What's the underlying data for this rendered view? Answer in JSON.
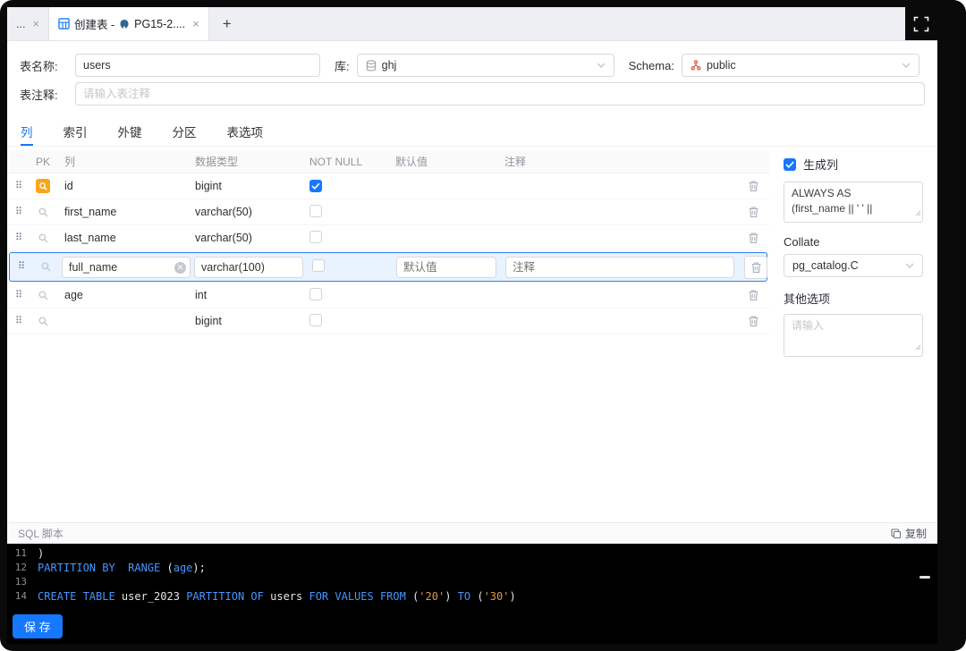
{
  "colors": {
    "accent": "#1677ff",
    "pk_badge": "#f6a71d",
    "sql_keyword": "#4596ff",
    "sql_string": "#de9a4a",
    "selected_row_bg": "#e9f2ff"
  },
  "window": {
    "tabs": {
      "partial": {
        "label": "...",
        "close": "×"
      },
      "active": {
        "prefix": "创建表 -",
        "suffix": "PG15-2....",
        "close": "×"
      },
      "add": "+"
    }
  },
  "form": {
    "table_name_label": "表名称:",
    "table_name_value": "users",
    "db_label": "库:",
    "db_value": "ghj",
    "schema_label": "Schema:",
    "schema_value": "public",
    "comment_label": "表注释:",
    "comment_placeholder": "请输入表注释"
  },
  "nav": {
    "tabs": [
      "列",
      "索引",
      "外键",
      "分区",
      "表选项"
    ],
    "active": "列"
  },
  "grid": {
    "headers": {
      "pk": "PK",
      "name": "列",
      "type": "数据类型",
      "not_null": "NOT NULL",
      "default": "默认值",
      "comment": "注释"
    },
    "rows": [
      {
        "name": "id",
        "type": "bigint",
        "not_null": true,
        "pk": true
      },
      {
        "name": "first_name",
        "type": "varchar(50)",
        "not_null": false
      },
      {
        "name": "last_name",
        "type": "varchar(50)",
        "not_null": false
      },
      {
        "name": "full_name",
        "type": "varchar(100)",
        "not_null": false,
        "selected": true,
        "default_placeholder": "默认值",
        "comment_placeholder": "注释"
      },
      {
        "name": "age",
        "type": "int",
        "not_null": false
      },
      {
        "name": "",
        "type": "bigint",
        "not_null": false
      }
    ]
  },
  "panel": {
    "generated_label": "生成列",
    "generated_checked": true,
    "generated_value": "ALWAYS AS\n(first_name || ' ' ||",
    "collate_label": "Collate",
    "collate_value": "pg_catalog.C",
    "other_label": "其他选项",
    "other_placeholder": "请输入"
  },
  "sql": {
    "title": "SQL 脚本",
    "copy": "复制",
    "lines": [
      {
        "num": "11",
        "tokens": [
          {
            "type": "plain",
            "text": ")"
          }
        ]
      },
      {
        "num": "12",
        "tokens": [
          {
            "type": "kw",
            "text": "PARTITION BY"
          },
          {
            "type": "plain",
            "text": "  "
          },
          {
            "type": "kw",
            "text": "RANGE"
          },
          {
            "type": "plain",
            "text": " ("
          },
          {
            "type": "kw",
            "text": "age"
          },
          {
            "type": "plain",
            "text": ");"
          }
        ]
      },
      {
        "num": "13",
        "tokens": []
      },
      {
        "num": "14",
        "tokens": [
          {
            "type": "kw",
            "text": "CREATE TABLE"
          },
          {
            "type": "plain",
            "text": " user_2023 "
          },
          {
            "type": "kw",
            "text": "PARTITION OF"
          },
          {
            "type": "plain",
            "text": " users "
          },
          {
            "type": "kw",
            "text": "FOR VALUES FROM"
          },
          {
            "type": "plain",
            "text": " ("
          },
          {
            "type": "str",
            "text": "'20'"
          },
          {
            "type": "plain",
            "text": ") "
          },
          {
            "type": "kw",
            "text": "TO"
          },
          {
            "type": "plain",
            "text": " ("
          },
          {
            "type": "str",
            "text": "'30'"
          },
          {
            "type": "plain",
            "text": ")"
          }
        ]
      }
    ]
  },
  "footer": {
    "save": "保 存"
  }
}
